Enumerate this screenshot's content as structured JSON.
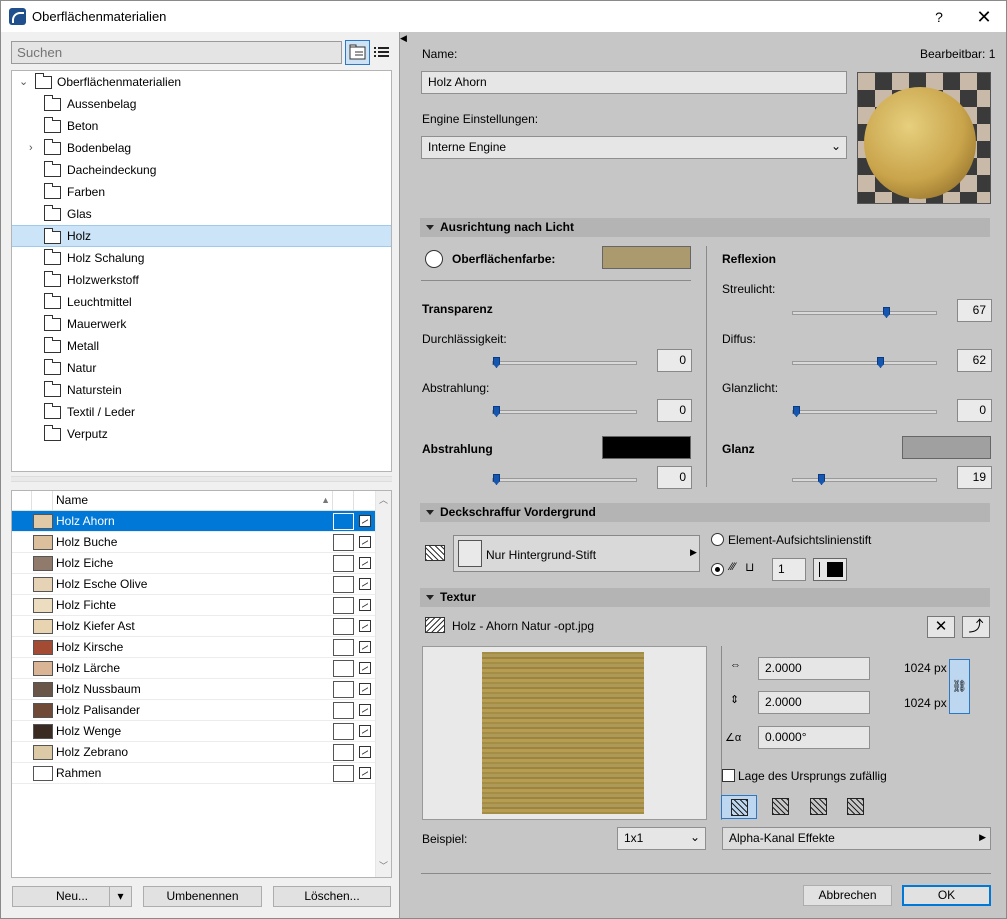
{
  "window": {
    "title": "Oberflächenmaterialien",
    "help_label": "?",
    "close_label": "✕"
  },
  "search": {
    "placeholder": "Suchen"
  },
  "tree": {
    "root": "Oberflächenmaterialien",
    "items": [
      {
        "label": "Aussenbelag",
        "expandable": false
      },
      {
        "label": "Beton",
        "expandable": false
      },
      {
        "label": "Bodenbelag",
        "expandable": true
      },
      {
        "label": "Dacheindeckung",
        "expandable": false
      },
      {
        "label": "Farben",
        "expandable": false
      },
      {
        "label": "Glas",
        "expandable": false
      },
      {
        "label": "Holz",
        "expandable": false,
        "selected": true
      },
      {
        "label": "Holz Schalung",
        "expandable": false
      },
      {
        "label": "Holzwerkstoff",
        "expandable": false
      },
      {
        "label": "Leuchtmittel",
        "expandable": false
      },
      {
        "label": "Mauerwerk",
        "expandable": false
      },
      {
        "label": "Metall",
        "expandable": false
      },
      {
        "label": "Natur",
        "expandable": false
      },
      {
        "label": "Naturstein",
        "expandable": false
      },
      {
        "label": "Textil / Leder",
        "expandable": false
      },
      {
        "label": "Verputz",
        "expandable": false
      }
    ]
  },
  "list": {
    "column_name": "Name",
    "rows": [
      {
        "name": "Holz Ahorn",
        "color": "#e0c9a6",
        "selected": true
      },
      {
        "name": "Holz Buche",
        "color": "#dcbf9d"
      },
      {
        "name": "Holz Eiche",
        "color": "#8f7a6b"
      },
      {
        "name": "Holz Esche Olive",
        "color": "#e6d3b5"
      },
      {
        "name": "Holz Fichte",
        "color": "#ecdcc0"
      },
      {
        "name": "Holz Kiefer Ast",
        "color": "#e8d4b0"
      },
      {
        "name": "Holz Kirsche",
        "color": "#a34b33"
      },
      {
        "name": "Holz Lärche",
        "color": "#d9b596"
      },
      {
        "name": "Holz Nussbaum",
        "color": "#6a5549"
      },
      {
        "name": "Holz Palisander",
        "color": "#6e4a37"
      },
      {
        "name": "Holz Wenge",
        "color": "#3a2b22"
      },
      {
        "name": "Holz Zebrano",
        "color": "#dcc9a6"
      },
      {
        "name": "Rahmen",
        "color": "#ffffff"
      }
    ]
  },
  "buttons": {
    "new": "Neu...",
    "new_dropdown": "▾",
    "rename": "Umbenennen",
    "delete": "Löschen...",
    "cancel": "Abbrechen",
    "ok": "OK"
  },
  "props": {
    "name_label": "Name:",
    "editable_label": "Bearbeitbar: 1",
    "name_value": "Holz Ahorn",
    "engine_label": "Engine Einstellungen:",
    "engine_value": "Interne Engine",
    "section_light": "Ausrichtung nach Licht",
    "surface_color_label": "Oberflächenfarbe:",
    "surface_color": "#aa9a6e",
    "transparency_label": "Transparenz",
    "permeability_label": "Durchlässigkeit:",
    "permeability_value": "0",
    "emission1_label": "Abstrahlung:",
    "emission1_value": "0",
    "emission_label": "Abstrahlung",
    "emission_color": "#000000",
    "emission_value": "0",
    "reflection_label": "Reflexion",
    "ambient_label": "Streulicht:",
    "ambient_value": "67",
    "diffuse_label": "Diffus:",
    "diffuse_value": "62",
    "specular_label": "Glanzlicht:",
    "specular_value": "0",
    "shine_label": "Glanz",
    "shine_color": "#a0a0a0",
    "shine_value": "19",
    "section_hatch": "Deckschraffur Vordergrund",
    "pen_label": "Nur Hintergrund-Stift",
    "element_pen_label": "Element-Aufsichtslinienstift",
    "pen_number": "1",
    "section_texture": "Textur",
    "texture_file": "Holz - Ahorn Natur -opt.jpg",
    "tex_width": "2.0000",
    "tex_height": "2.0000",
    "tex_angle": "0.0000°",
    "px_width": "1024 px",
    "px_height": "1024 px",
    "random_origin_label": "Lage des Ursprungs zufällig",
    "sample_label": "Beispiel:",
    "sample_value": "1x1",
    "alpha_label": "Alpha-Kanal Effekte"
  }
}
